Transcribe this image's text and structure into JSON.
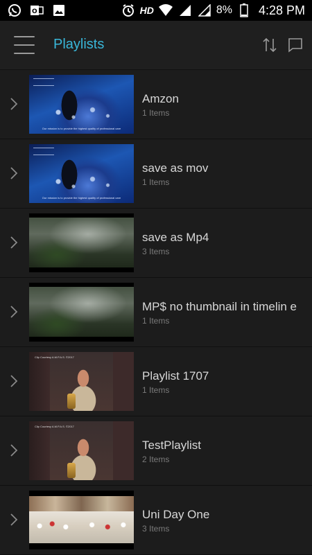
{
  "status_bar": {
    "hd_label": "HD",
    "battery_percent": "8%",
    "time": "4:28 PM"
  },
  "app_bar": {
    "title": "Playlists",
    "accent_color": "#39b7d9"
  },
  "playlists": [
    {
      "name": "Amzon",
      "count": "1 Items",
      "thumb_caption": "Our mission is to provide the highest quality of professional care"
    },
    {
      "name": "save as mov",
      "count": "1 Items",
      "thumb_caption": "Our mission is to provide the highest quality of professional care"
    },
    {
      "name": "save as Mp4",
      "count": "3 Items"
    },
    {
      "name": "MP$ no thumbnail in timelin e",
      "count": "1 Items"
    },
    {
      "name": "Playlist 1707",
      "count": "1 Items",
      "thumb_caption": "Clip Courtesy A.M.P.A.S. ©2017"
    },
    {
      "name": "TestPlaylist",
      "count": "2 Items",
      "thumb_caption": "Clip Courtesy A.M.P.A.S. ©2017"
    },
    {
      "name": "Uni Day One",
      "count": "3 Items"
    }
  ]
}
